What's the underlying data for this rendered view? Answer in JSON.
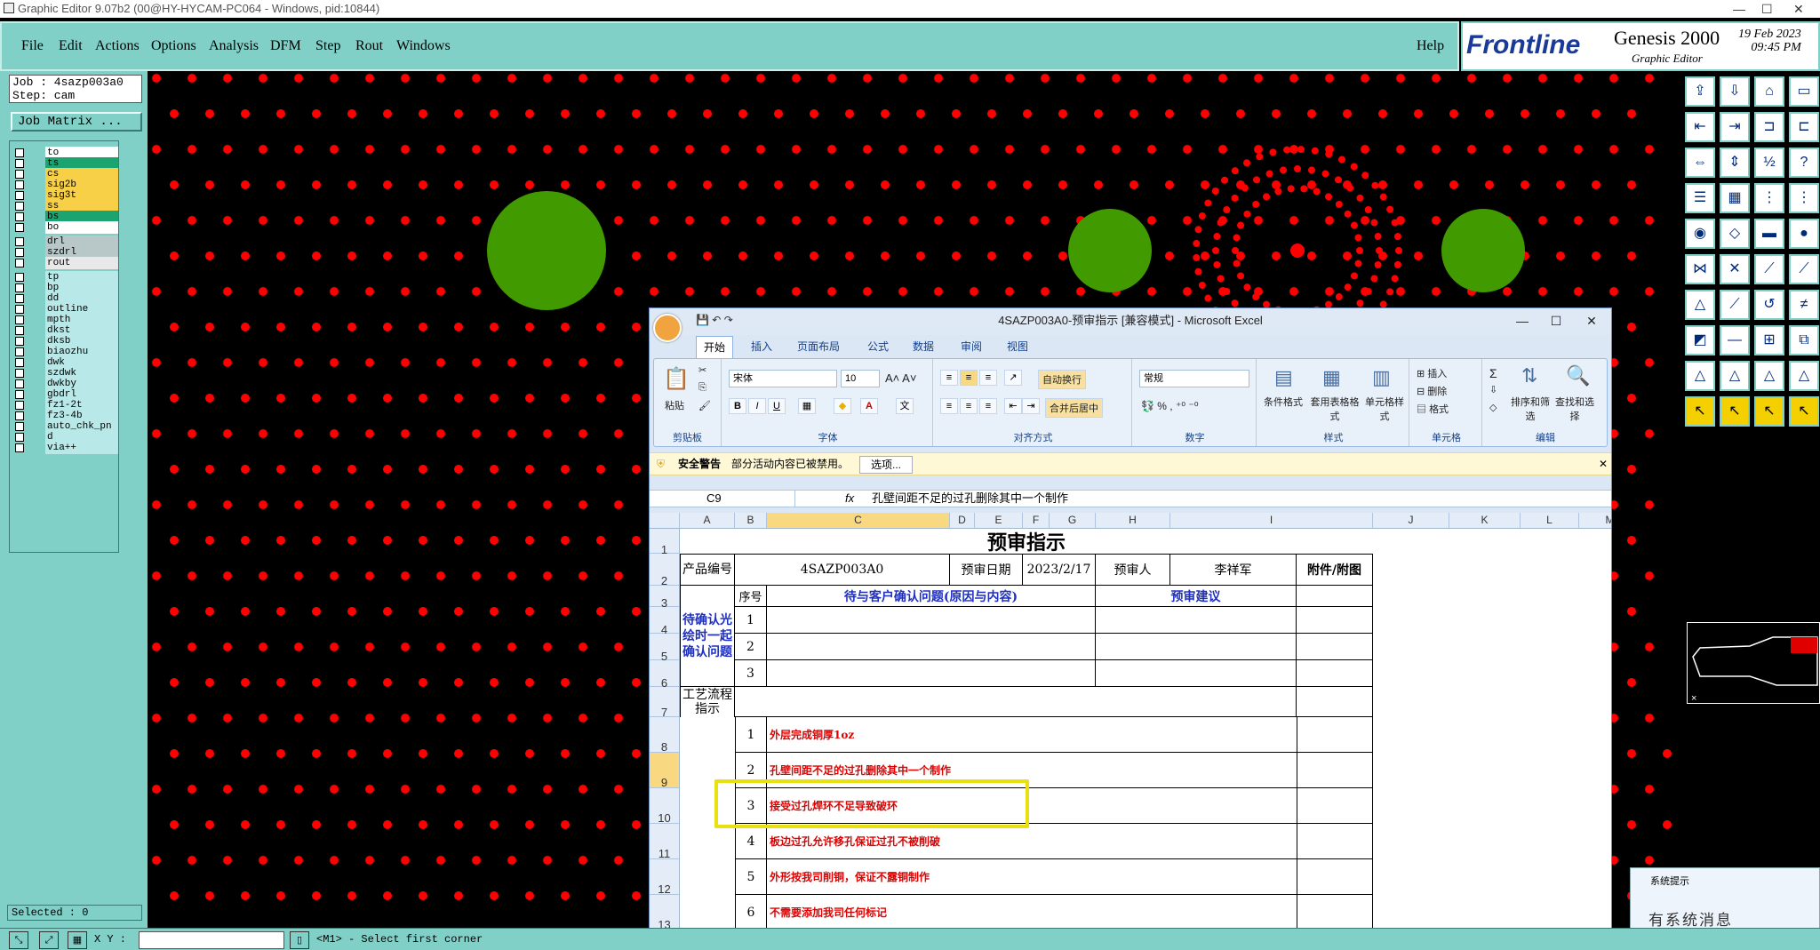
{
  "window": {
    "title": "Graphic Editor 9.07b2 (00@HY-HYCAM-PC064 - Windows, pid:10844)"
  },
  "menu": {
    "items": [
      "File",
      "Edit",
      "Actions",
      "Options",
      "Analysis",
      "DFM",
      "Step",
      "Rout",
      "Windows"
    ],
    "help": "Help"
  },
  "brand": {
    "logo": "Frontline",
    "product": "Genesis 2000",
    "subtitle": "Graphic Editor",
    "date": "19 Feb 2023",
    "time": "09:45 PM"
  },
  "job": {
    "job_line": "Job : 4sazp003a0",
    "step_line": "Step: cam",
    "matrix_button": "Job Matrix ..."
  },
  "layers": [
    {
      "name": "to",
      "color": "#ffffff"
    },
    {
      "name": "ts",
      "color": "#1ca470"
    },
    {
      "name": "cs",
      "color": "#f8d048"
    },
    {
      "name": "sig2b",
      "color": "#f8d048"
    },
    {
      "name": "sig3t",
      "color": "#f8d048"
    },
    {
      "name": "ss",
      "color": "#f8d048"
    },
    {
      "name": "bs",
      "color": "#1ca470"
    },
    {
      "name": "bo",
      "color": "#ffffff"
    },
    {
      "name": "drl",
      "color": "#b8c8c8"
    },
    {
      "name": "szdrl",
      "color": "#b8c8c8"
    },
    {
      "name": "rout",
      "color": "#e8e8e8"
    },
    {
      "name": "tp",
      "color": "#b8e8e8"
    },
    {
      "name": "bp",
      "color": "#b8e8e8"
    },
    {
      "name": "dd",
      "color": "#b8e8e8"
    },
    {
      "name": "outline",
      "color": "#b8e8e8"
    },
    {
      "name": "mpth",
      "color": "#b8e8e8"
    },
    {
      "name": "dkst",
      "color": "#b8e8e8"
    },
    {
      "name": "dksb",
      "color": "#b8e8e8"
    },
    {
      "name": "biaozhu",
      "color": "#b8e8e8"
    },
    {
      "name": "dwk",
      "color": "#b8e8e8"
    },
    {
      "name": "szdwk",
      "color": "#b8e8e8"
    },
    {
      "name": "dwkby",
      "color": "#b8e8e8"
    },
    {
      "name": "gbdrl",
      "color": "#b8e8e8"
    },
    {
      "name": "fz1-2t",
      "color": "#b8e8e8"
    },
    {
      "name": "fz3-4b",
      "color": "#b8e8e8"
    },
    {
      "name": "auto_chk_pn",
      "color": "#b8e8e8"
    },
    {
      "name": "d",
      "color": "#b8e8e8"
    },
    {
      "name": "via++",
      "color": "#b8e8e8"
    }
  ],
  "status": {
    "selected": "Selected : 0",
    "xy_label": "X Y :",
    "message": "<M1> - Select first corner"
  },
  "notice": {
    "title": "系统提示",
    "message": "有系统消息"
  },
  "excel": {
    "title": "4SAZP003A0-预审指示 [兼容模式] - Microsoft Excel",
    "tabs": [
      "开始",
      "插入",
      "页面布局",
      "公式",
      "数据",
      "审阅",
      "视图"
    ],
    "ribbon": {
      "clipboard": {
        "label": "剪贴板",
        "paste": "粘贴"
      },
      "font": {
        "label": "字体",
        "name": "宋体",
        "size": "10"
      },
      "align": {
        "label": "对齐方式",
        "wrap": "自动换行",
        "merge": "合并后居中"
      },
      "number": {
        "label": "数字",
        "format": "常规"
      },
      "styles": {
        "label": "样式",
        "conditional": "条件格式",
        "table": "套用表格格式",
        "cell": "单元格样式"
      },
      "cells": {
        "label": "单元格",
        "insert": "插入",
        "delete": "删除",
        "format": "格式"
      },
      "edit": {
        "label": "编辑",
        "sort": "排序和筛选",
        "find": "查找和选择"
      }
    },
    "security": {
      "title": "安全警告",
      "message": "部分活动内容已被禁用。",
      "options": "选项..."
    },
    "formula": {
      "cell": "C9",
      "fx": "fx",
      "value": "孔壁间距不足的过孔删除其中一个制作"
    },
    "columns": [
      "A",
      "B",
      "C",
      "D",
      "E",
      "F",
      "G",
      "H",
      "I",
      "J",
      "K",
      "L",
      "M"
    ],
    "sheet": {
      "title": "预审指示",
      "product_label": "产品编号",
      "product_value": "4SAZP003A0",
      "date_label": "预审日期",
      "date_value": "2023/2/17",
      "reviewer_label": "预审人",
      "reviewer_value": "李祥军",
      "attach_label": "附件/附图",
      "seq_label": "序号",
      "issue_header": "待与客户确认问题(原因与内容)",
      "suggest_header": "预审建议",
      "pending_label": "待确认光绘时一起确认问题",
      "pending_rows": [
        "1",
        "2",
        "3"
      ],
      "process_label": "工艺流程指示",
      "process_rows": [
        {
          "n": "1",
          "text": "外层完成铜厚1oz"
        },
        {
          "n": "2",
          "text": "孔壁间距不足的过孔删除其中一个制作"
        },
        {
          "n": "3",
          "text": "接受过孔焊环不足导致破环"
        },
        {
          "n": "4",
          "text": "板边过孔允许移孔保证过孔不被削破"
        },
        {
          "n": "5",
          "text": "外形按我司削铜，保证不露铜制作"
        },
        {
          "n": "6",
          "text": "不需要添加我司任何标记"
        }
      ]
    }
  }
}
